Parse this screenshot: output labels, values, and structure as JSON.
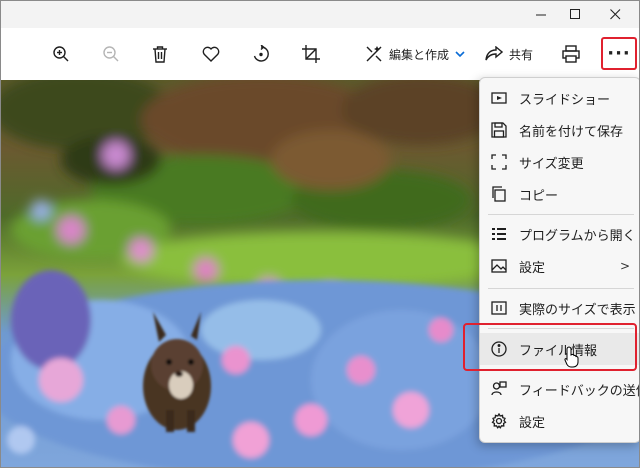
{
  "window": {
    "minimize_icon": "minimize-icon",
    "maximize_icon": "maximize-icon",
    "close_icon": "close-icon"
  },
  "toolbar": {
    "zoom_in_icon": "zoom-in-icon",
    "zoom_out_icon": "zoom-out-icon",
    "delete_icon": "trash-icon",
    "favorite_icon": "heart-icon",
    "rotate_icon": "rotate-icon",
    "crop_icon": "crop-icon",
    "edit_create_label": "編集と作成",
    "share_label": "共有",
    "print_icon": "printer-icon",
    "more_label": "···"
  },
  "menu": {
    "items": [
      {
        "label": "スライドショー",
        "icon": "slideshow-icon"
      },
      {
        "label": "名前を付けて保存",
        "icon": "save-icon"
      },
      {
        "label": "サイズ変更",
        "icon": "resize-icon"
      },
      {
        "label": "コピー",
        "icon": "copy-icon"
      },
      {
        "label": "プログラムから開く",
        "icon": "open-with-icon"
      },
      {
        "label": "設定",
        "icon": "wallpaper-icon",
        "has_submenu": true
      },
      {
        "label": "実際のサイズで表示",
        "icon": "actual-size-icon"
      },
      {
        "label": "ファイル情報",
        "icon": "info-icon",
        "hovered": true
      },
      {
        "label": "フィードバックの送信",
        "icon": "feedback-icon"
      },
      {
        "label": "設定",
        "icon": "gear-icon"
      }
    ],
    "submenu_arrow": ">"
  },
  "colors": {
    "highlight_box": "#e0212f",
    "accent": "#0a6cd6"
  }
}
